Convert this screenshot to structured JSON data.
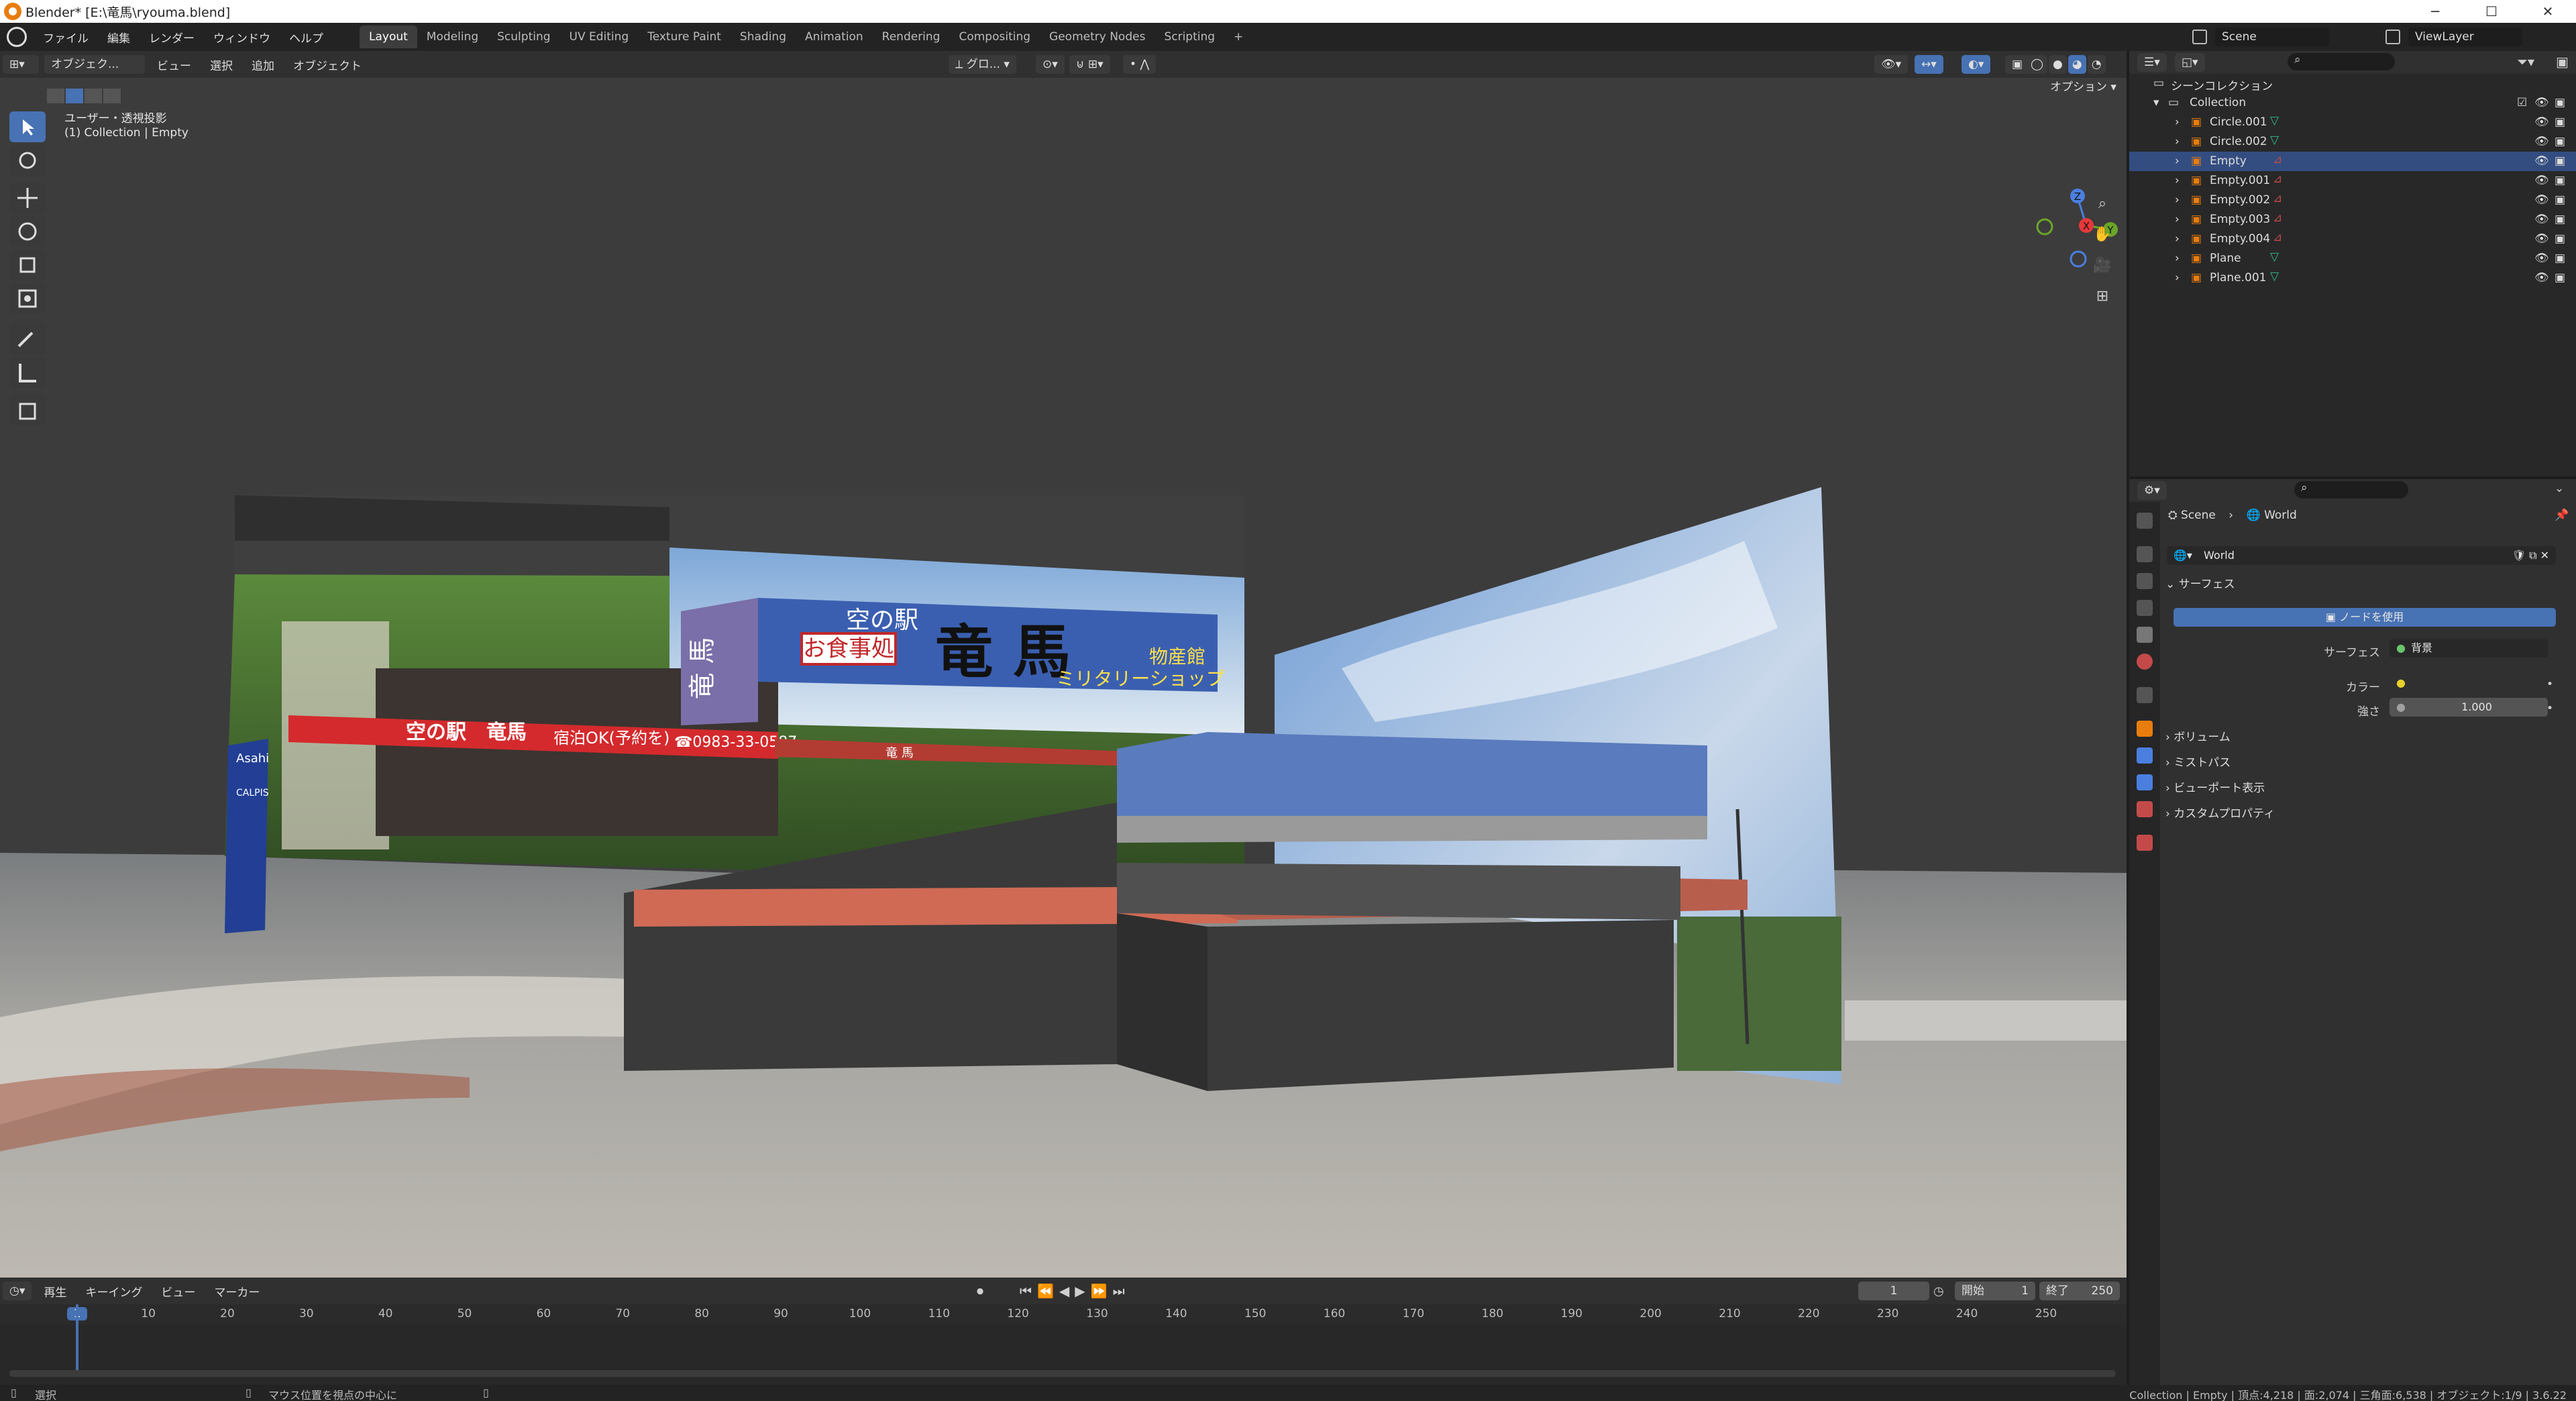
{
  "window": {
    "title": "Blender* [E:\\竜馬\\ryouma.blend]",
    "controls": [
      "─",
      "☐",
      "✕"
    ]
  },
  "menu": {
    "items": [
      "ファイル",
      "編集",
      "レンダー",
      "ウィンドウ",
      "ヘルプ"
    ],
    "workspaces": [
      "Layout",
      "Modeling",
      "Sculpting",
      "UV Editing",
      "Texture Paint",
      "Shading",
      "Animation",
      "Rendering",
      "Compositing",
      "Geometry Nodes",
      "Scripting"
    ],
    "active_workspace": "Layout",
    "add_tab": "+",
    "scene_label": "Scene",
    "viewlayer_label": "ViewLayer"
  },
  "viewport_header": {
    "mode": "オブジェク...",
    "menus": [
      "ビュー",
      "選択",
      "追加",
      "オブジェクト"
    ],
    "transform_orient": "グロ...",
    "options": "オプション"
  },
  "viewport": {
    "view_name": "ユーザー・透視投影",
    "collection_info": "(1) Collection | Empty",
    "gizmo": {
      "z": "Z",
      "x": "X",
      "y": "Y"
    },
    "signs": {
      "main_sign_top": "空の駅",
      "main_sign_name": "竜 馬",
      "main_sign_sub": "お食事処",
      "main_sign_right1": "物産館",
      "main_sign_right2": "ミリタリーショップ",
      "banner_text": "空の駅　竜馬",
      "banner_stay": "宿泊OK(予約を)",
      "banner_phone": "☎0983-33-0587",
      "awning_text": "竜 馬",
      "vertical_left": "竜 馬",
      "flag_text": "Asahi",
      "flag_text2": "CALPIS"
    }
  },
  "outliner": {
    "scene_collection": "シーンコレクション",
    "collection": "Collection",
    "items": [
      {
        "name": "Circle.001",
        "type": "mesh"
      },
      {
        "name": "Circle.002",
        "type": "mesh"
      },
      {
        "name": "Empty",
        "type": "empty",
        "selected": true
      },
      {
        "name": "Empty.001",
        "type": "empty"
      },
      {
        "name": "Empty.002",
        "type": "empty"
      },
      {
        "name": "Empty.003",
        "type": "empty"
      },
      {
        "name": "Empty.004",
        "type": "empty"
      },
      {
        "name": "Plane",
        "type": "mesh"
      },
      {
        "name": "Plane.001",
        "type": "mesh"
      }
    ]
  },
  "properties": {
    "breadcrumb_scene": "Scene",
    "breadcrumb_sep": "›",
    "breadcrumb_world": "World",
    "world_name": "World",
    "surface_panel": "サーフェス",
    "use_nodes_btn": "ノードを使用",
    "surface_label": "サーフェス",
    "surface_value": "背景",
    "color_label": "カラー",
    "strength_label": "強さ",
    "strength_value": "1.000",
    "panels": [
      "ボリューム",
      "ミストパス",
      "ビューポート表示",
      "カスタムプロパティ"
    ]
  },
  "timeline": {
    "menus": [
      "再生",
      "キーイング",
      "ビュー",
      "マーカー"
    ],
    "current_frame": "1",
    "start_label": "開始",
    "start_value": "1",
    "end_label": "終了",
    "end_value": "250",
    "ticks": [
      "1",
      "10",
      "20",
      "30",
      "40",
      "50",
      "60",
      "70",
      "80",
      "90",
      "100",
      "110",
      "120",
      "130",
      "140",
      "150",
      "160",
      "170",
      "180",
      "190",
      "200",
      "210",
      "220",
      "230",
      "240",
      "250"
    ]
  },
  "status_bar": {
    "left": "選択",
    "middle": "マウス位置を視点の中心に",
    "right": "Collection | Empty | 頂点:4,218 | 面:2,074 | 三角面:6,538 | オブジェクト:1/9 | 3.6.22"
  },
  "colors": {
    "accent": "#4772b3",
    "selected_row": "#334d80",
    "orange": "#e87d0d",
    "axis_x": "#e8383b",
    "axis_y": "#6aa628",
    "axis_z": "#4a7fe0"
  }
}
